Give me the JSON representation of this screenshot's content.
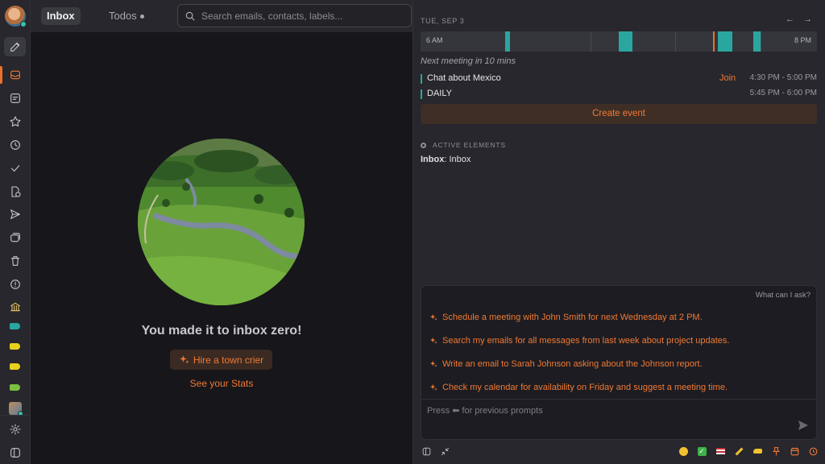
{
  "topbar": {
    "tab_inbox": "Inbox",
    "tab_todos": "Todos",
    "search_placeholder": "Search emails, contacts, labels..."
  },
  "sidebar": {
    "icons": [
      "compose-icon",
      "inbox-icon",
      "notes-icon",
      "star-icon",
      "clock-icon",
      "check-icon",
      "drafts-icon",
      "send-icon",
      "folders-icon",
      "trash-icon",
      "alert-icon",
      "bank-icon",
      "label-teal",
      "label-yellow",
      "label-yellow",
      "label-green",
      "workspace-avatar",
      "settings-icon",
      "collapse-sidebar-icon"
    ],
    "label_colors": [
      "#2aa6a0",
      "#e8d11e",
      "#e8d11e",
      "#7bc043"
    ]
  },
  "main": {
    "title": "You made it to inbox zero!",
    "button": "Hire a town crier",
    "link": "See your Stats"
  },
  "calendar": {
    "date": "TUE, SEP 3",
    "nav": "← →",
    "start_label": "6 AM",
    "end_label": "8 PM",
    "next_meeting": "Next meeting in 10 mins",
    "events": [
      {
        "name": "Chat about Mexico",
        "action": "Join",
        "time": "4:30 PM - 5:00 PM"
      },
      {
        "name": "DAILY",
        "action": "",
        "time": "5:45 PM - 6:00 PM"
      }
    ],
    "create": "Create event",
    "accent": "#2aa6a0"
  },
  "active_elements": {
    "heading": "ACTIVE ELEMENTS",
    "label": "Inbox",
    "value": ": Inbox"
  },
  "assistant": {
    "hint": "What can I ask?",
    "suggestions": [
      "Schedule a meeting with John Smith for next Wednesday at 2 PM.",
      "Search my emails for all messages from last week about project updates.",
      "Write an email to Sarah Johnson asking about the Johnson report.",
      "Check my calendar for availability on Friday and suggest a meeting time."
    ],
    "prompt_placeholder": "Press ⬅ for previous prompts"
  },
  "colors": {
    "accent": "#f07a33",
    "background": "#17161b",
    "panel": "#27272d"
  }
}
